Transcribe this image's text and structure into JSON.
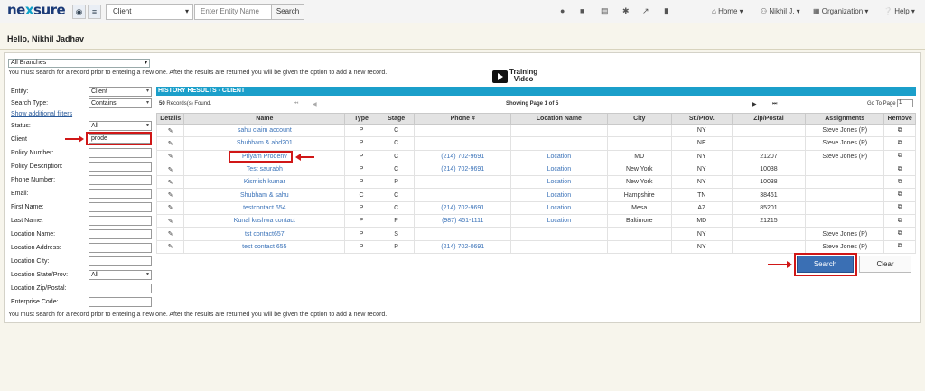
{
  "header": {
    "logo": "nexsure",
    "entity_select": "Client",
    "entity_placeholder": "Enter Entity Name",
    "search_label": "Search",
    "nav": {
      "home": "Home",
      "user": "Nikhil J.",
      "organization": "Organization",
      "help": "Help"
    }
  },
  "greeting": "Hello, Nikhil Jadhav",
  "branches": "All Branches",
  "note_top": "You must search for a record prior to entering a new one. After the results are returned you will be given the option to add a new record.",
  "note_bottom": "You must search for a record prior to entering a new one. After the results are returned you will be given the option to add a new record.",
  "training": {
    "line1": "Training",
    "line2": "Video"
  },
  "filters": {
    "entity_label": "Entity:",
    "entity_value": "Client",
    "search_type_label": "Search Type:",
    "search_type_value": "Contains",
    "show_additional": "Show additional filters",
    "status_label": "Status:",
    "status_value": "All",
    "client_label": "Client",
    "client_value": "prode",
    "policy_number": "Policy Number:",
    "policy_description": "Policy Description:",
    "phone_number": "Phone Number:",
    "email": "Email:",
    "first_name": "First Name:",
    "last_name": "Last Name:",
    "location_name": "Location Name:",
    "location_address": "Location Address:",
    "location_city": "Location City:",
    "location_state": "Location State/Prov:",
    "location_state_value": "All",
    "location_zip": "Location Zip/Postal:",
    "enterprise_code": "Enterprise Code:"
  },
  "results": {
    "heading": "HISTORY RESULTS - CLIENT",
    "records_count": "50",
    "records_label": "Records(s) Found.",
    "page_info": "Showing Page 1 of 5",
    "goto_label": "Go To Page",
    "goto_value": "1",
    "columns": [
      "Details",
      "Name",
      "Type",
      "Stage",
      "Phone #",
      "Location Name",
      "City",
      "St./Prov.",
      "Zip/Postal",
      "Assignments",
      "Remove"
    ],
    "rows": [
      {
        "name": "sahu claim account",
        "type": "P",
        "stage": "C",
        "phone": "",
        "location": "",
        "city": "",
        "state": "NY",
        "zip": "",
        "assign": "Steve Jones (P)"
      },
      {
        "name": "Shubham & abd201",
        "type": "P",
        "stage": "C",
        "phone": "",
        "location": "",
        "city": "",
        "state": "NE",
        "zip": "",
        "assign": "Steve Jones (P)"
      },
      {
        "name": "Priyam Prodenv",
        "type": "P",
        "stage": "C",
        "phone": "(214) 702-9691",
        "location": "Location",
        "city": "MD",
        "state": "NY",
        "zip": "21207",
        "assign": "Steve Jones (P)"
      },
      {
        "name": "Test saurabh",
        "type": "P",
        "stage": "C",
        "phone": "(214) 702-9691",
        "location": "Location",
        "city": "New York",
        "state": "NY",
        "zip": "10038",
        "assign": ""
      },
      {
        "name": "Kismish kumar",
        "type": "P",
        "stage": "P",
        "phone": "",
        "location": "Location",
        "city": "New York",
        "state": "NY",
        "zip": "10038",
        "assign": ""
      },
      {
        "name": "Shubham & sahu",
        "type": "C",
        "stage": "C",
        "phone": "",
        "location": "Location",
        "city": "Hampshire",
        "state": "TN",
        "zip": "38461",
        "assign": ""
      },
      {
        "name": "testcontact 654",
        "type": "P",
        "stage": "C",
        "phone": "(214) 702-9691",
        "location": "Location",
        "city": "Mesa",
        "state": "AZ",
        "zip": "85201",
        "assign": ""
      },
      {
        "name": "Kunal kushwa contact",
        "type": "P",
        "stage": "P",
        "phone": "(987) 451-1111",
        "location": "Location",
        "city": "Baltimore",
        "state": "MD",
        "zip": "21215",
        "assign": ""
      },
      {
        "name": "tst contact657",
        "type": "P",
        "stage": "S",
        "phone": "",
        "location": "",
        "city": "",
        "state": "NY",
        "zip": "",
        "assign": "Steve Jones (P)"
      },
      {
        "name": "test contact 655",
        "type": "P",
        "stage": "P",
        "phone": "(214) 702-0691",
        "location": "",
        "city": "",
        "state": "NY",
        "zip": "",
        "assign": "Steve Jones (P)"
      }
    ]
  },
  "buttons": {
    "search": "Search",
    "clear": "Clear"
  }
}
